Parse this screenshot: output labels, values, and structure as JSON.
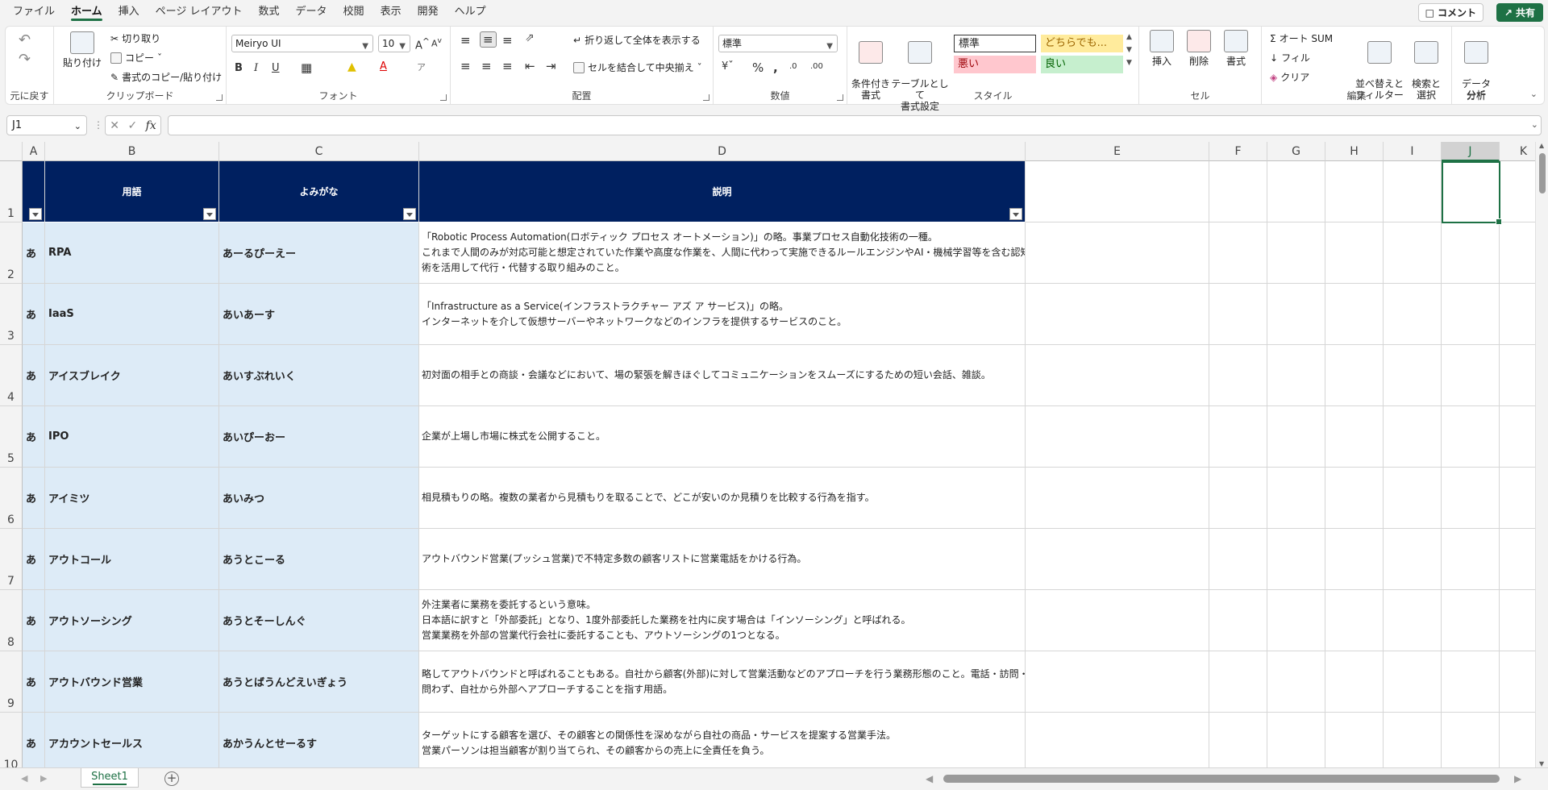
{
  "menu": {
    "tabs": [
      "ファイル",
      "ホーム",
      "挿入",
      "ページ レイアウト",
      "数式",
      "データ",
      "校閲",
      "表示",
      "開発",
      "ヘルプ"
    ],
    "active": "ホーム",
    "comment": "コメント",
    "share": "共有"
  },
  "ribbon": {
    "undo": {
      "label": "元に戻す"
    },
    "clipboard": {
      "label": "クリップボード",
      "paste": "貼り付け",
      "cut": "切り取り",
      "copy": "コピー",
      "format_painter": "書式のコピー/貼り付け"
    },
    "font": {
      "label": "フォント",
      "name": "Meiryo UI",
      "size": "10",
      "bold": "B",
      "italic": "I",
      "underline": "U"
    },
    "alignment": {
      "label": "配置",
      "wrap": "折り返して全体を表示する",
      "merge": "セルを結合して中央揃え"
    },
    "number": {
      "label": "数値",
      "format": "標準",
      "percent": "%"
    },
    "style": {
      "label": "スタイル",
      "conditional": "条件付き\n書式",
      "table": "テーブルとして\n書式設定",
      "normal": "標準",
      "neutral": "どちらでも...",
      "bad": "悪い",
      "good": "良い"
    },
    "cells": {
      "label": "セル",
      "insert": "挿入",
      "delete": "削除",
      "format": "書式"
    },
    "editing": {
      "label": "編集",
      "autosum": "オート SUM",
      "fill": "フィル",
      "clear": "クリア",
      "sort": "並べ替えと\nフィルター",
      "find": "検索と\n選択"
    },
    "analysis": {
      "label": "分析",
      "data_analysis": "データ\n分析"
    }
  },
  "formula_bar": {
    "name_box": "J1",
    "formula": ""
  },
  "columns": [
    "A",
    "B",
    "C",
    "D",
    "E",
    "F",
    "G",
    "H",
    "I",
    "J",
    "K"
  ],
  "headers": {
    "term": "用語",
    "reading": "よみがな",
    "description": "説明"
  },
  "rows": [
    {
      "num": "2",
      "a": "あ",
      "term": "RPA",
      "reading": "あーるぴーえー",
      "desc": [
        "「Robotic Process Automation(ロボティック プロセス オートメーション)」の略。事業プロセス自動化技術の一種。",
        "これまで人間のみが対応可能と想定されていた作業や高度な作業を、人間に代わって実施できるルールエンジンやAI・機械学習等を含む認知技",
        "術を活用して代行・代替する取り組みのこと。"
      ]
    },
    {
      "num": "3",
      "a": "あ",
      "term": "IaaS",
      "reading": "あいあーす",
      "desc": [
        "「Infrastructure as a Service(インフラストラクチャー アズ ア サービス)」の略。",
        "インターネットを介して仮想サーバーやネットワークなどのインフラを提供するサービスのこと。"
      ]
    },
    {
      "num": "4",
      "a": "あ",
      "term": "アイスブレイク",
      "reading": "あいすぶれいく",
      "desc": [
        "初対面の相手との商談・会議などにおいて、場の緊張を解きほぐしてコミュニケーションをスムーズにするための短い会話、雑談。"
      ]
    },
    {
      "num": "5",
      "a": "あ",
      "term": "IPO",
      "reading": "あいぴーおー",
      "desc": [
        "企業が上場し市場に株式を公開すること。"
      ]
    },
    {
      "num": "6",
      "a": "あ",
      "term": "アイミツ",
      "reading": "あいみつ",
      "desc": [
        "相見積もりの略。複数の業者から見積もりを取ることで、どこが安いのか見積りを比較する行為を指す。"
      ]
    },
    {
      "num": "7",
      "a": "あ",
      "term": "アウトコール",
      "reading": "あうとこーる",
      "desc": [
        "アウトバウンド営業(プッシュ営業)で不特定多数の顧客リストに営業電話をかける行為。"
      ]
    },
    {
      "num": "8",
      "a": "あ",
      "term": "アウトソーシング",
      "reading": "あうとそーしんぐ",
      "desc": [
        "外注業者に業務を委託するという意味。",
        "日本語に訳すと「外部委託」となり、1度外部委託した業務を社内に戻す場合は「インソーシング」と呼ばれる。",
        "営業業務を外部の営業代行会社に委託することも、アウトソーシングの1つとなる。"
      ]
    },
    {
      "num": "9",
      "a": "あ",
      "term": "アウトバウンド営業",
      "reading": "あうとばうんどえいぎょう",
      "desc": [
        "略してアウトバウンドと呼ばれることもある。自社から顧客(外部)に対して営業活動などのアプローチを行う業務形態のこと。電話・訪問・勧誘などを",
        "問わず、自社から外部へアプローチすることを指す用語。"
      ]
    },
    {
      "num": "10",
      "a": "あ",
      "term": "アカウントセールス",
      "reading": "あかうんとせーるす",
      "desc": [
        "ターゲットにする顧客を選び、その顧客との関係性を深めながら自社の商品・サービスを提案する営業手法。",
        "営業パーソンは担当顧客が割り当てられ、その顧客からの売上に全責任を負う。"
      ]
    }
  ],
  "sheet": {
    "name": "Sheet1"
  }
}
